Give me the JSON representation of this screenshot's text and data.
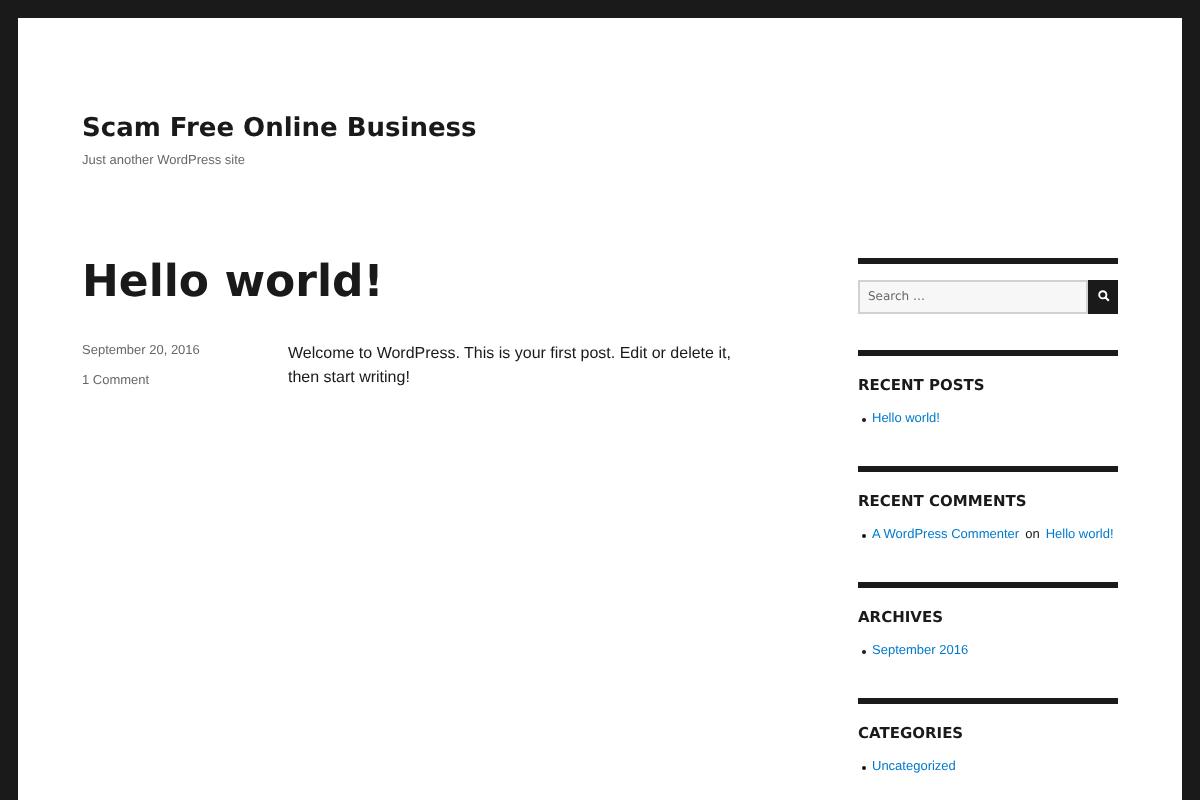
{
  "site": {
    "title": "Scam Free Online Business",
    "tagline": "Just another WordPress site"
  },
  "post": {
    "title": "Hello world!",
    "date": "September 20, 2016",
    "comments": "1 Comment",
    "body": "Welcome to WordPress. This is your first post. Edit or delete it, then start writing!"
  },
  "sidebar": {
    "search": {
      "placeholder": "Search …"
    },
    "widgets": [
      {
        "title": "RECENT POSTS",
        "items": [
          {
            "parts": [
              {
                "text": "Hello world!",
                "link": true
              }
            ]
          }
        ]
      },
      {
        "title": "RECENT COMMENTS",
        "items": [
          {
            "parts": [
              {
                "text": "A WordPress Commenter",
                "link": true
              },
              {
                "text": "on",
                "link": false
              },
              {
                "text": "Hello world!",
                "link": true
              }
            ]
          }
        ]
      },
      {
        "title": "ARCHIVES",
        "items": [
          {
            "parts": [
              {
                "text": "September 2016",
                "link": true
              }
            ]
          }
        ]
      },
      {
        "title": "CATEGORIES",
        "items": [
          {
            "parts": [
              {
                "text": "Uncategorized",
                "link": true
              }
            ]
          }
        ]
      }
    ]
  }
}
